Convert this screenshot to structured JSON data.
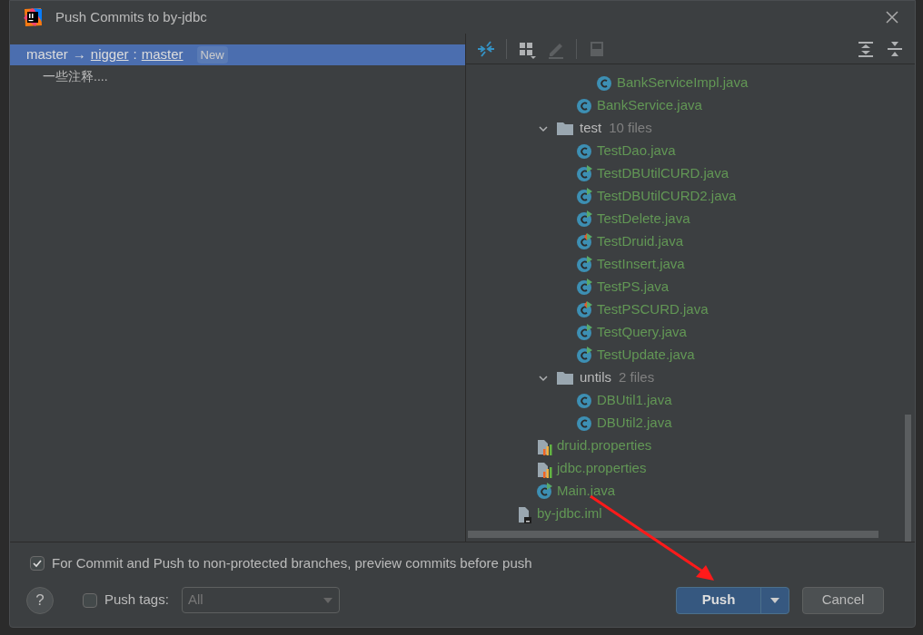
{
  "window": {
    "title": "Push Commits to by-jdbc"
  },
  "commits": [
    {
      "local_branch": "master",
      "arrow": "→",
      "remote": "nigger",
      "separator": ":",
      "remote_branch": "master",
      "badge": "New",
      "selected": true,
      "children": [
        {
          "message": "一些注释....",
          "selected": false
        }
      ]
    }
  ],
  "toolbar": [
    {
      "kind": "collapse",
      "disabled": false
    },
    {
      "kind": "group",
      "disabled": false
    },
    {
      "kind": "edit",
      "disabled": true
    },
    {
      "kind": "preview",
      "disabled": true
    },
    {
      "kind": "expand-all",
      "disabled": false
    },
    {
      "kind": "collapse-all",
      "disabled": false
    }
  ],
  "tree": [
    {
      "children": [
        {
          "children": [
            {
              "children": [
                {
                  "children": [
                    {
                      "kind": "class",
                      "label": "BankServiceImpl.java"
                    }
                  ]
                },
                {
                  "kind": "class",
                  "label": "BankService.java"
                }
              ]
            },
            {
              "kind": "folder",
              "label": "test",
              "count": "10 files",
              "expanded": true,
              "children": [
                {
                  "kind": "class",
                  "label": "TestDao.java"
                },
                {
                  "kind": "test",
                  "label": "TestDBUtilCURD.java"
                },
                {
                  "kind": "test",
                  "label": "TestDBUtilCURD2.java"
                },
                {
                  "kind": "test",
                  "label": "TestDelete.java"
                },
                {
                  "kind": "test-mixed",
                  "label": "TestDruid.java"
                },
                {
                  "kind": "test",
                  "label": "TestInsert.java"
                },
                {
                  "kind": "test",
                  "label": "TestPS.java"
                },
                {
                  "kind": "test-mixed",
                  "label": "TestPSCURD.java"
                },
                {
                  "kind": "test",
                  "label": "TestQuery.java"
                },
                {
                  "kind": "test",
                  "label": "TestUpdate.java"
                }
              ]
            },
            {
              "kind": "folder",
              "label": "untils",
              "count": "2 files",
              "expanded": true,
              "children": [
                {
                  "kind": "class",
                  "label": "DBUtil1.java"
                },
                {
                  "kind": "class",
                  "label": "DBUtil2.java"
                }
              ]
            }
          ]
        },
        {
          "kind": "properties",
          "label": "druid.properties"
        },
        {
          "kind": "properties",
          "label": "jdbc.properties"
        },
        {
          "kind": "test",
          "label": "Main.java"
        }
      ]
    },
    {
      "kind": "iml",
      "label": "by-jdbc.iml"
    }
  ],
  "options": {
    "preview": {
      "label": "For Commit and Push to non-protected branches, preview commits before push",
      "checked": true
    },
    "push_tags": {
      "label": "Push tags:",
      "checked": false,
      "value": "All",
      "disabled": true
    }
  },
  "buttons": {
    "help": "?",
    "push": "Push",
    "cancel": "Cancel"
  }
}
